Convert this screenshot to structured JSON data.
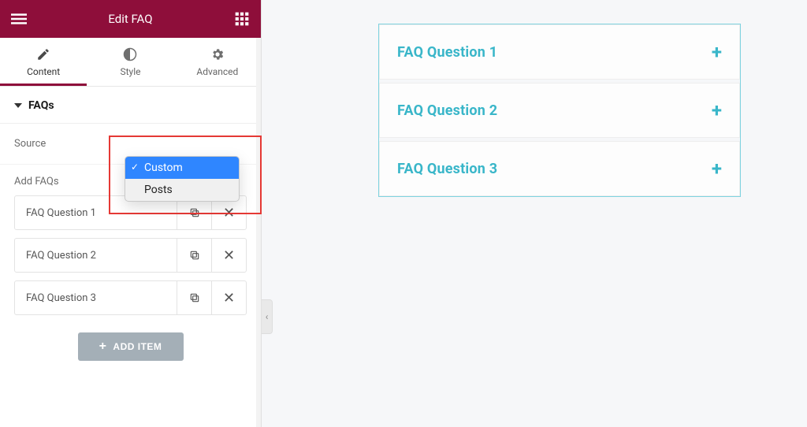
{
  "header": {
    "title": "Edit FAQ"
  },
  "tabs": [
    {
      "label": "Content",
      "active": true
    },
    {
      "label": "Style",
      "active": false
    },
    {
      "label": "Advanced",
      "active": false
    }
  ],
  "section": {
    "title": "FAQs"
  },
  "source": {
    "label": "Source",
    "selected": "Custom",
    "options": [
      "Custom",
      "Posts"
    ]
  },
  "addFaqs": {
    "label": "Add FAQs",
    "items": [
      "FAQ Question 1",
      "FAQ Question 2",
      "FAQ Question 3"
    ]
  },
  "addItemButton": "ADD ITEM",
  "preview": {
    "questions": [
      "FAQ Question 1",
      "FAQ Question 2",
      "FAQ Question 3"
    ]
  },
  "icons": {
    "hamburger": "menu-icon",
    "apps": "apps-icon",
    "content": "pencil-icon",
    "style": "contrast-icon",
    "advanced": "gear-icon",
    "duplicate": "copy-icon",
    "remove": "close-icon",
    "collapse": "chevron-left-icon",
    "expand": "plus-icon"
  }
}
